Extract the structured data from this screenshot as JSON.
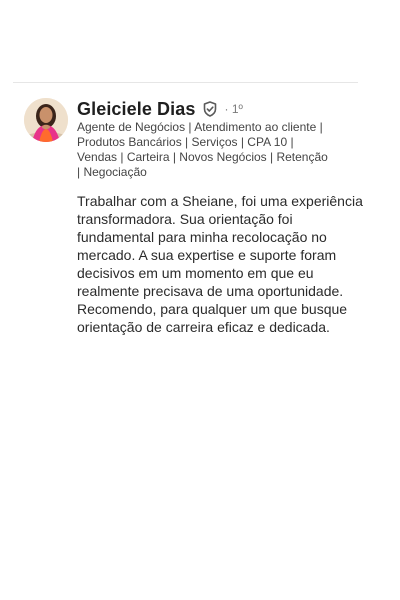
{
  "recommendation": {
    "author_name": "Gleiciele Dias",
    "verified_icon": "verified-shield-icon",
    "connection_degree": "· 1º",
    "headline": "Agente de Negócios | Atendimento ao cliente |\nProdutos Bancários | Serviços | CPA 10 |\nVendas | Carteira | Novos Negócios | Retenção\n| Negociação",
    "text": "Trabalhar com a Sheiane, foi uma experiência\ntransformadora. Sua orientação foi\nfundamental para minha recolocação no\nmercado. A sua expertise e suporte foram\ndecisivos em um momento em que eu\nrealmente precisava de uma oportunidade.\nRecomendo, para qualquer um que busque\norientação de carreira eficaz e dedicada."
  },
  "colors": {
    "name_text": "#1f1f1f",
    "secondary_text": "#454545",
    "divider": "#e6e6e6"
  }
}
